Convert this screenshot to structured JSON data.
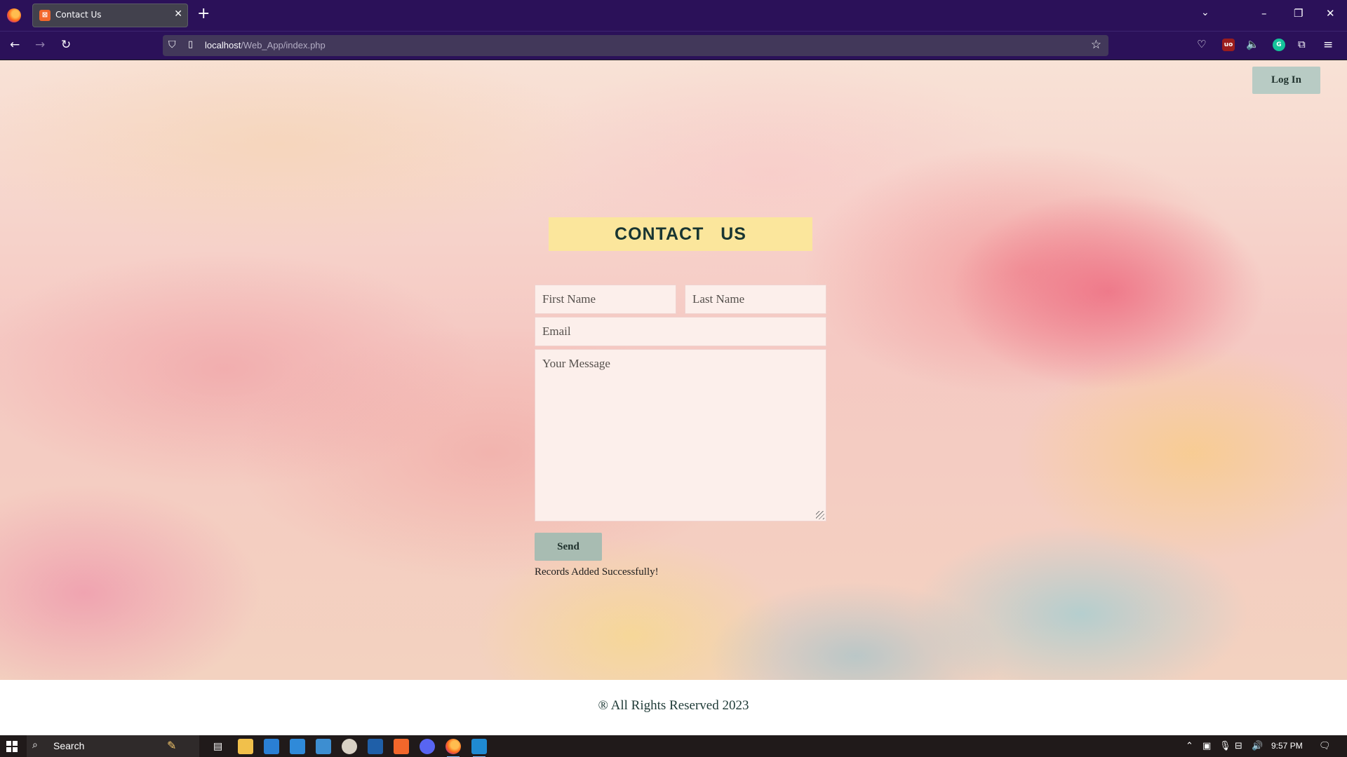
{
  "browser": {
    "tab": {
      "title": "Contact Us",
      "favicon": "xampp-favicon"
    },
    "url": {
      "host": "localhost",
      "path": "/Web_App/index.php"
    }
  },
  "page": {
    "login_label": "Log In",
    "heading": "CONTACT   US",
    "form": {
      "first_name_placeholder": "First Name",
      "last_name_placeholder": "Last Name",
      "email_placeholder": "Email",
      "message_placeholder": "Your Message",
      "send_label": "Send"
    },
    "status_message": "Records Added Successfully!",
    "footer": "® All Rights Reserved 2023"
  },
  "colors": {
    "heading_bg": "#fbe69c",
    "button_bg": "#b8cbc4",
    "field_bg": "#fcefeb",
    "browser_chrome": "#2b1159"
  },
  "taskbar": {
    "search_label": "Search",
    "time": "9:57 PM"
  }
}
